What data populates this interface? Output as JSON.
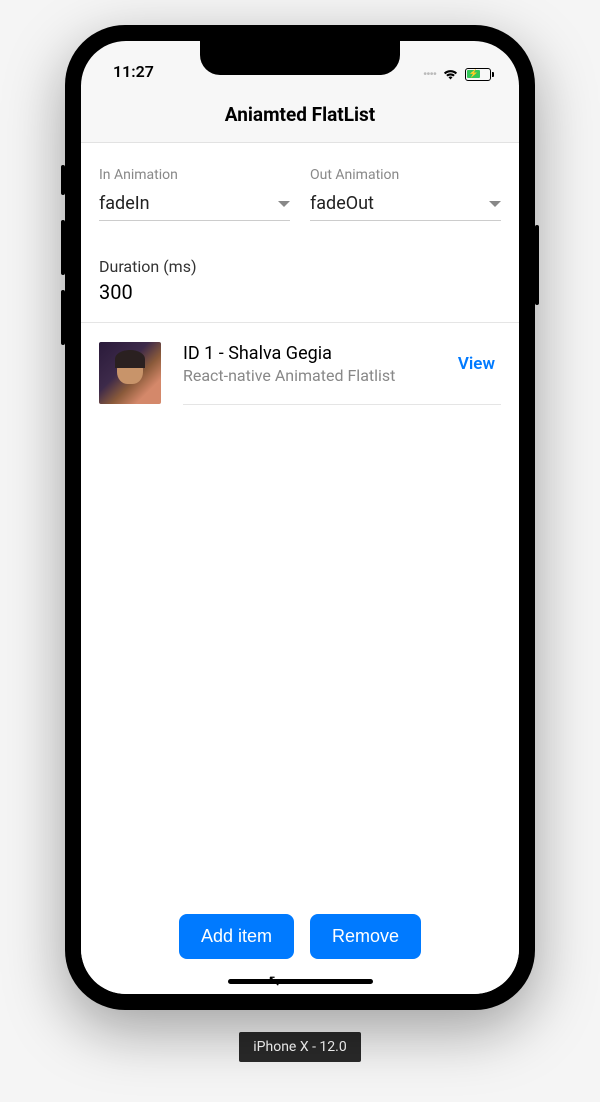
{
  "status_bar": {
    "time": "11:27"
  },
  "header": {
    "title": "Aniamted FlatList"
  },
  "form": {
    "in_animation": {
      "label": "In Animation",
      "value": "fadeIn"
    },
    "out_animation": {
      "label": "Out Animation",
      "value": "fadeOut"
    },
    "duration": {
      "label": "Duration (ms)",
      "value": "300"
    }
  },
  "list": {
    "items": [
      {
        "title": "ID 1 - Shalva Gegia",
        "subtitle": "React-native Animated Flatlist",
        "action": "View"
      }
    ]
  },
  "actions": {
    "add_label": "Add item",
    "remove_label": "Remove"
  },
  "device_label": "iPhone X - 12.0"
}
